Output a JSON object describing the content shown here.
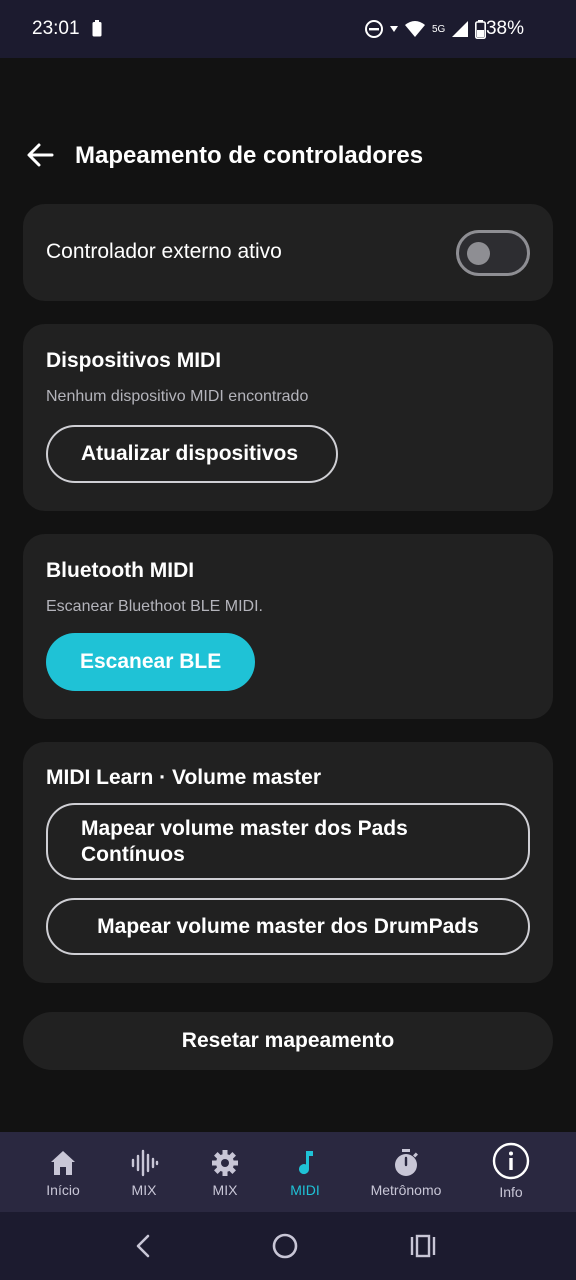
{
  "status_bar": {
    "time": "23:01",
    "battery_percent": "38%",
    "network": "5G",
    "icons": [
      "battery-saver-icon",
      "do-not-disturb-icon",
      "wifi-icon",
      "signal-icon",
      "battery-icon"
    ]
  },
  "header": {
    "title": "Mapeamento de controladores"
  },
  "external_controller": {
    "label": "Controlador externo ativo",
    "enabled": false
  },
  "midi_devices": {
    "title": "Dispositivos MIDI",
    "subtitle": "Nenhum dispositivo MIDI encontrado",
    "refresh_label": "Atualizar dispositivos"
  },
  "bluetooth_midi": {
    "title": "Bluetooth MIDI",
    "subtitle": "Escanear Bluethoot BLE MIDI.",
    "scan_label": "Escanear BLE"
  },
  "midi_learn": {
    "title": "MIDI Learn · Volume master",
    "map_pads_line1": "Mapear volume master dos Pads",
    "map_pads_line2": "Contínuos",
    "map_drumpads_label": "Mapear volume master dos DrumPads"
  },
  "reset_label": "Resetar mapeamento",
  "bottom_nav": {
    "items": [
      {
        "label": "Início",
        "icon": "home-icon"
      },
      {
        "label": "MIX",
        "icon": "waveform-icon"
      },
      {
        "label": "MIX",
        "icon": "gear-icon"
      },
      {
        "label": "MIDI",
        "icon": "music-note-icon",
        "active": true
      },
      {
        "label": "Metrônomo",
        "icon": "stopwatch-icon"
      },
      {
        "label": "Info",
        "icon": "info-icon"
      }
    ]
  },
  "colors": {
    "accent": "#1fc2d6",
    "background": "#121212",
    "card": "#212121",
    "nav_background": "#2a2840"
  }
}
